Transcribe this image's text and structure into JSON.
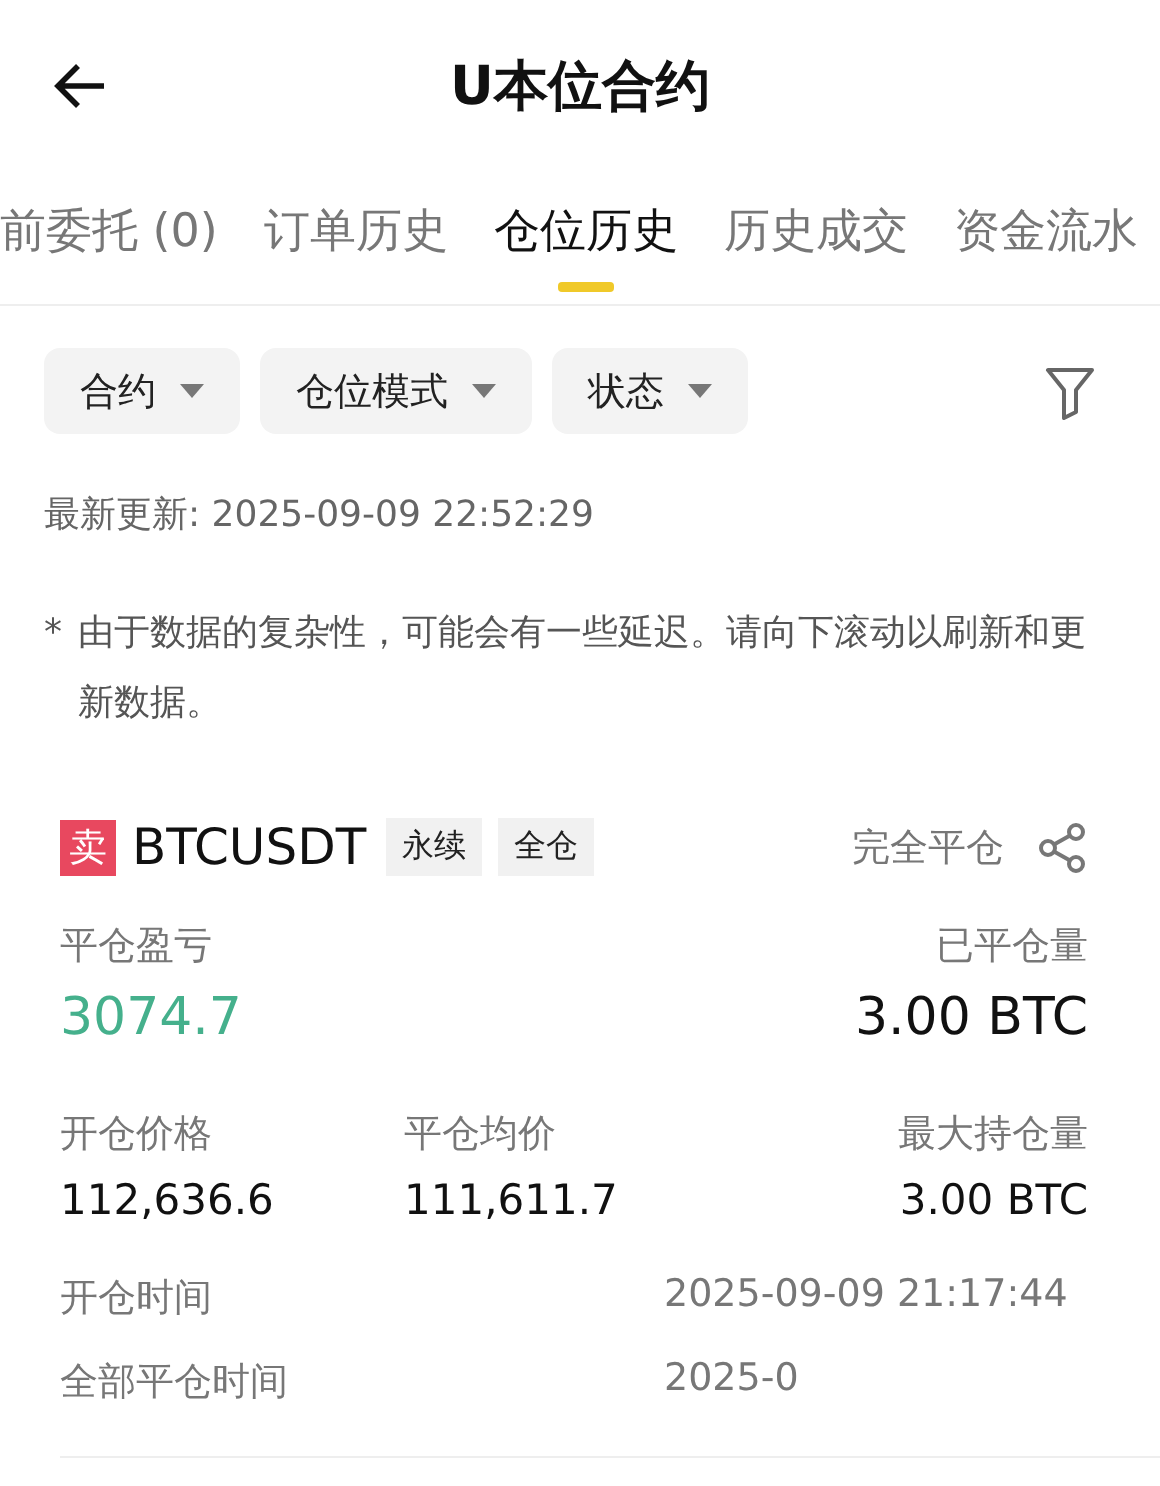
{
  "header": {
    "title": "U本位合约"
  },
  "tabs": [
    {
      "label": "前委托 (0)",
      "selected": false
    },
    {
      "label": "订单历史",
      "selected": false
    },
    {
      "label": "仓位历史",
      "selected": true
    },
    {
      "label": "历史成交",
      "selected": false
    },
    {
      "label": "资金流水",
      "selected": false
    }
  ],
  "filters": [
    "合约",
    "仓位模式",
    "状态"
  ],
  "last_updated": "最新更新: 2025-09-09 22:52:29",
  "note_mark": "*",
  "note": "由于数据的复杂性，可能会有一些延迟。请向下滚动以刷新和更新数据。",
  "position": {
    "side": "卖",
    "kind": "sell",
    "symbol": "BTCUSDT",
    "tags": [
      "永续",
      "全仓"
    ],
    "status": "完全平仓",
    "stats": [
      {
        "label": "平仓盈亏",
        "value": "3074.7",
        "kind": "profit"
      },
      {
        "label": "已平仓量",
        "value": "3.00 BTC",
        "kind": "normal"
      }
    ],
    "prices": [
      {
        "label": "开仓价格",
        "value": "112,636.6"
      },
      {
        "label": "平仓均价",
        "value": "111,611.7"
      },
      {
        "label": "最大持仓量",
        "value": "3.00  BTC"
      }
    ],
    "times": [
      {
        "label": "开仓时间",
        "value": "2025-09-09 21:17:44"
      },
      {
        "label": "全部平仓时间",
        "value": "2025-0"
      }
    ]
  }
}
